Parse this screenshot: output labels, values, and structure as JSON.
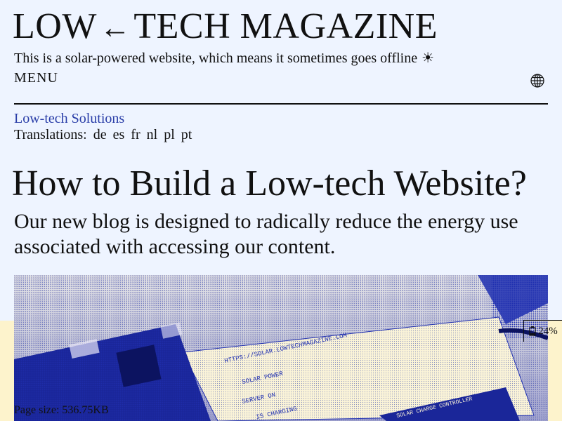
{
  "site": {
    "logo_left": "LOW",
    "logo_arrow": "←",
    "logo_right": "TECH MAGAZINE",
    "tagline": "This is a solar-powered website, which means it sometimes goes offline",
    "tagline_icon": "☀",
    "menu_label": "MENU"
  },
  "article": {
    "category": "Low-tech Solutions",
    "translations_label": "Translations:",
    "translations": [
      "de",
      "es",
      "fr",
      "nl",
      "pl",
      "pt"
    ],
    "title": "How to Build a Low-tech Website?",
    "lead": "Our new blog is designed to radically reduce the energy use associated with accessing our content."
  },
  "hero": {
    "labels": [
      "HTTPS://SOLAR.LOWTECHMAGAZINE.COM",
      "SOLAR POWER",
      "SERVER ON",
      "IS CHARGING",
      "SOLAR CHARGE CONTROLLER"
    ]
  },
  "status": {
    "battery_icon": "battery-icon",
    "battery_text": "24%",
    "page_size_text": "Page size: 536.75KB"
  },
  "colors": {
    "background": "#eef4ff",
    "link": "#2a3ea8",
    "yellow_band": "#fdf3cc",
    "duotone_blue": "#1f2fb0"
  }
}
